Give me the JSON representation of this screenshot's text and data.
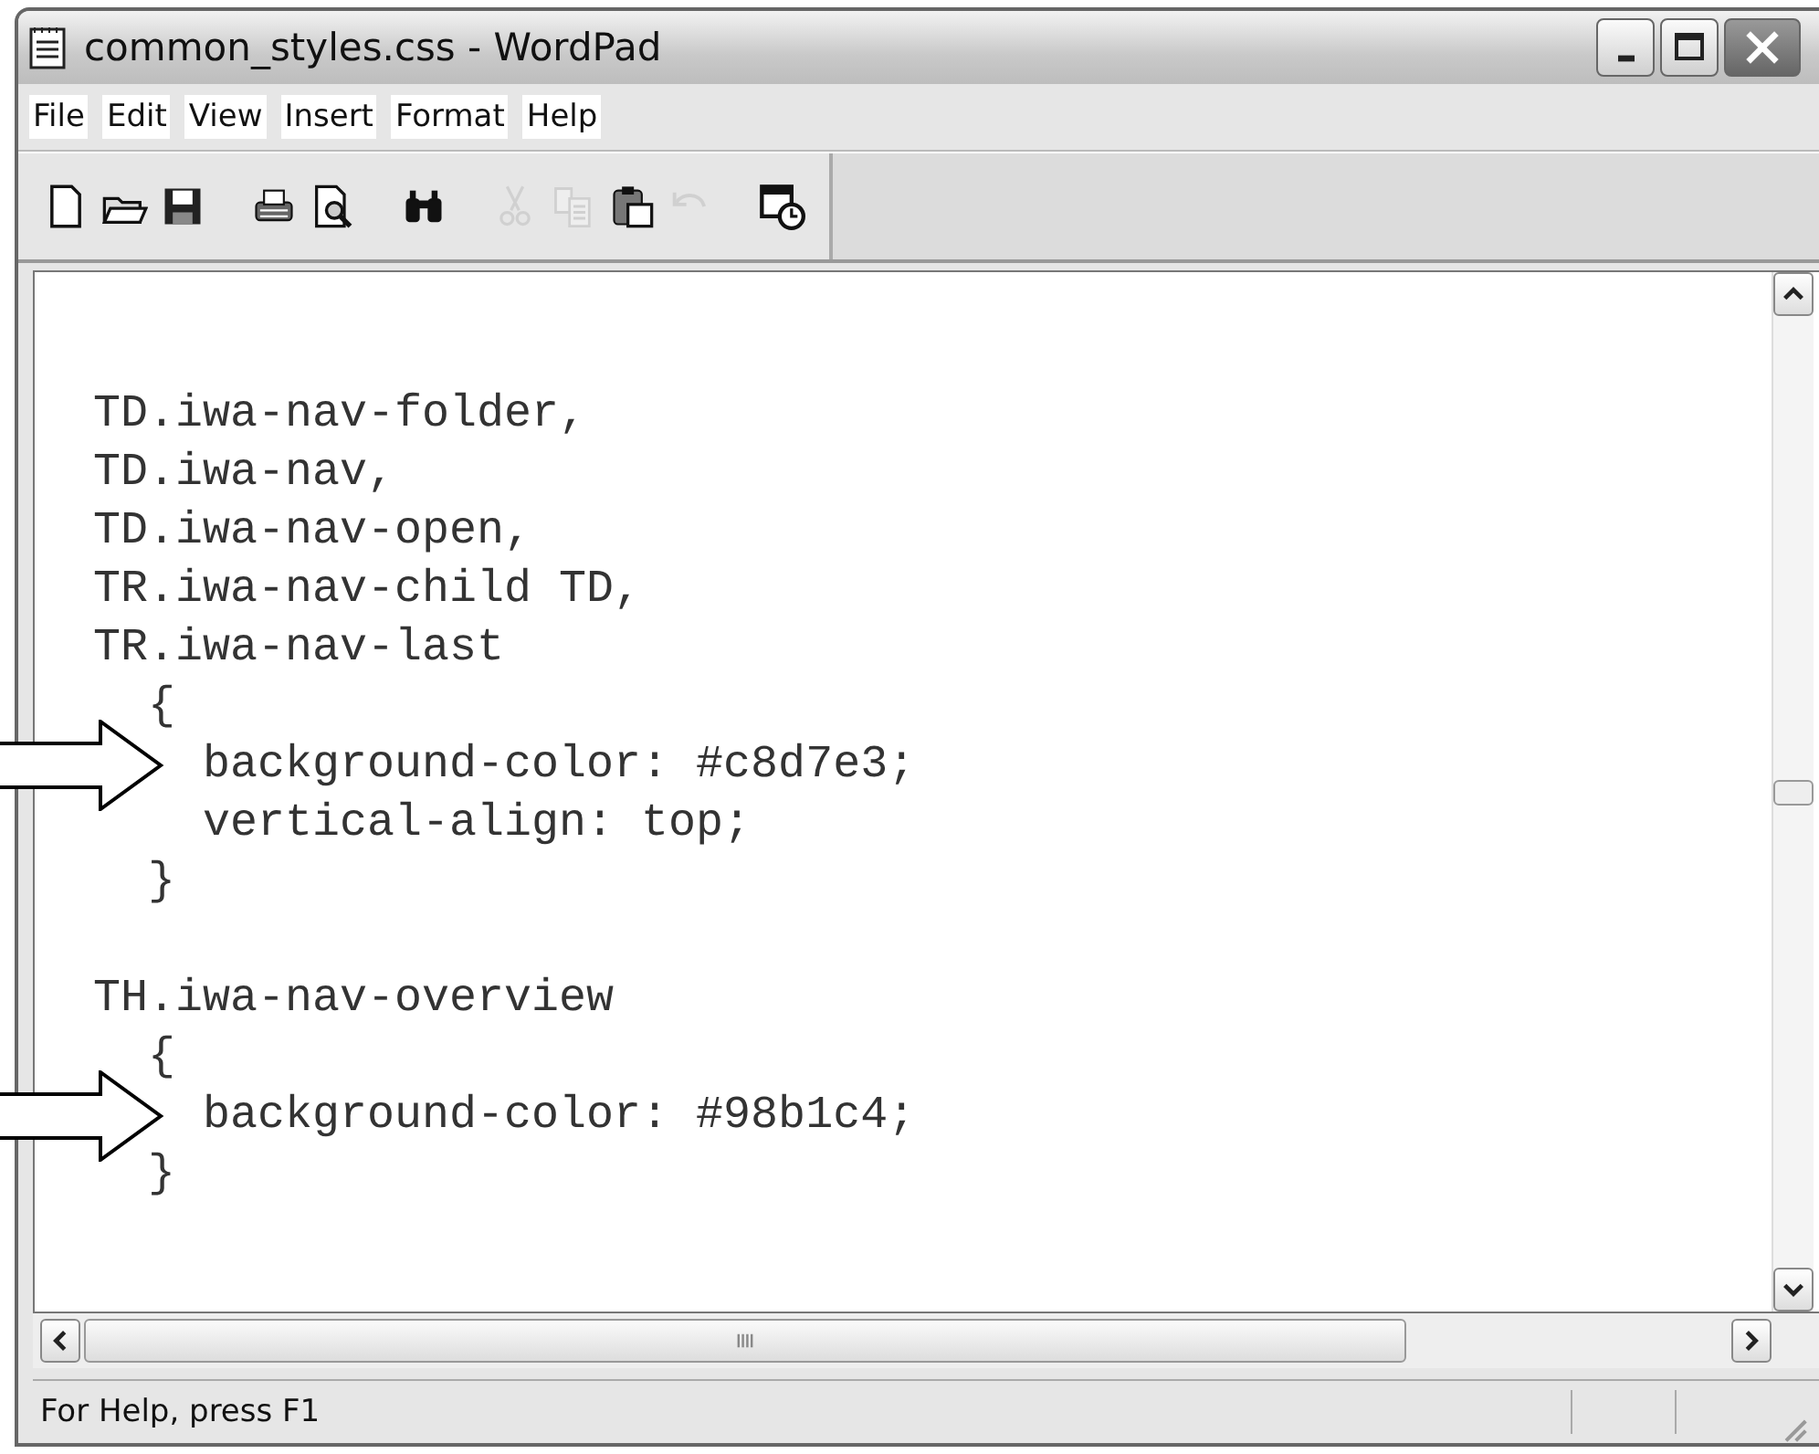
{
  "window": {
    "title": "common_styles.css - WordPad"
  },
  "menu": [
    "File",
    "Edit",
    "View",
    "Insert",
    "Format",
    "Help"
  ],
  "toolbar": [
    {
      "kind": "new",
      "disabled": false
    },
    {
      "kind": "open",
      "disabled": false
    },
    {
      "kind": "save",
      "disabled": false
    },
    {
      "kind": "gap"
    },
    {
      "kind": "print",
      "disabled": false
    },
    {
      "kind": "preview",
      "disabled": false
    },
    {
      "kind": "gap"
    },
    {
      "kind": "find",
      "disabled": false
    },
    {
      "kind": "gap"
    },
    {
      "kind": "cut",
      "disabled": true
    },
    {
      "kind": "copy",
      "disabled": true
    },
    {
      "kind": "paste",
      "disabled": false
    },
    {
      "kind": "undo",
      "disabled": true
    },
    {
      "kind": "gap"
    },
    {
      "kind": "datetime",
      "disabled": false
    }
  ],
  "document": {
    "blocks": [
      {
        "lines": [
          {
            "text": "TD.iwa-nav-folder,",
            "arrow": false
          },
          {
            "text": "TD.iwa-nav,",
            "arrow": false
          },
          {
            "text": "TD.iwa-nav-open,",
            "arrow": false
          },
          {
            "text": "TR.iwa-nav-child TD,",
            "arrow": false
          },
          {
            "text": "TR.iwa-nav-last",
            "arrow": false
          },
          {
            "text": "  {",
            "arrow": false
          },
          {
            "text": "    background-color: #c8d7e3;",
            "arrow": true
          },
          {
            "text": "    vertical-align: top;",
            "arrow": false
          },
          {
            "text": "  }",
            "arrow": false
          }
        ]
      },
      {
        "lines": [
          {
            "text": "TH.iwa-nav-overview",
            "arrow": false
          },
          {
            "text": "  {",
            "arrow": false
          },
          {
            "text": "    background-color: #98b1c4;",
            "arrow": true
          },
          {
            "text": "  }",
            "arrow": false
          }
        ]
      }
    ]
  },
  "status_bar": {
    "text": "For Help, press F1"
  }
}
